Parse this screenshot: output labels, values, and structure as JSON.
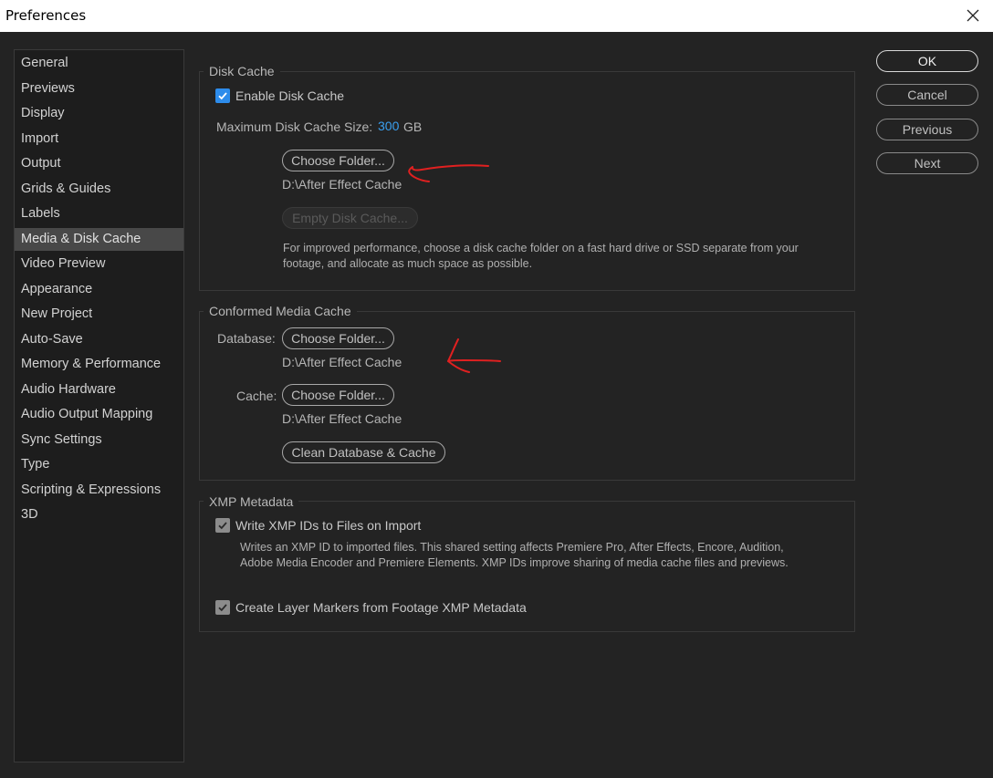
{
  "window": {
    "title": "Preferences"
  },
  "sidebar": {
    "items": [
      {
        "label": "General"
      },
      {
        "label": "Previews"
      },
      {
        "label": "Display"
      },
      {
        "label": "Import"
      },
      {
        "label": "Output"
      },
      {
        "label": "Grids & Guides"
      },
      {
        "label": "Labels"
      },
      {
        "label": "Media & Disk Cache",
        "selected": true
      },
      {
        "label": "Video Preview"
      },
      {
        "label": "Appearance"
      },
      {
        "label": "New Project"
      },
      {
        "label": "Auto-Save"
      },
      {
        "label": "Memory & Performance"
      },
      {
        "label": "Audio Hardware"
      },
      {
        "label": "Audio Output Mapping"
      },
      {
        "label": "Sync Settings"
      },
      {
        "label": "Type"
      },
      {
        "label": "Scripting & Expressions"
      },
      {
        "label": "3D"
      }
    ]
  },
  "disk_cache": {
    "title": "Disk Cache",
    "enable_label": "Enable Disk Cache",
    "enable_checked": true,
    "max_size_label": "Maximum Disk Cache Size:",
    "max_size_value": "300",
    "max_size_unit": "GB",
    "choose_folder": "Choose Folder...",
    "path": "D:\\After Effect Cache",
    "empty_cache": "Empty Disk Cache...",
    "note": "For improved performance, choose a disk cache folder on a fast hard drive or SSD separate from your footage, and allocate as much space as possible."
  },
  "conformed_cache": {
    "title": "Conformed Media Cache",
    "database_label": "Database:",
    "database_button": "Choose Folder...",
    "database_path": "D:\\After Effect Cache",
    "cache_label": "Cache:",
    "cache_button": "Choose Folder...",
    "cache_path": "D:\\After Effect Cache",
    "clean_button": "Clean Database & Cache"
  },
  "xmp": {
    "title": "XMP Metadata",
    "write_ids_label": "Write XMP IDs to Files on Import",
    "write_ids_checked": true,
    "write_ids_note": "Writes an XMP ID to imported files. This shared setting affects Premiere Pro, After Effects, Encore, Audition, Adobe Media Encoder and Premiere Elements. XMP IDs improve sharing of media cache files and previews.",
    "layer_markers_label": "Create Layer Markers from Footage XMP Metadata",
    "layer_markers_checked": true
  },
  "actions": {
    "ok": "OK",
    "cancel": "Cancel",
    "previous": "Previous",
    "next": "Next"
  },
  "colors": {
    "accent": "#3aa0f0",
    "annotation": "#e02020"
  }
}
